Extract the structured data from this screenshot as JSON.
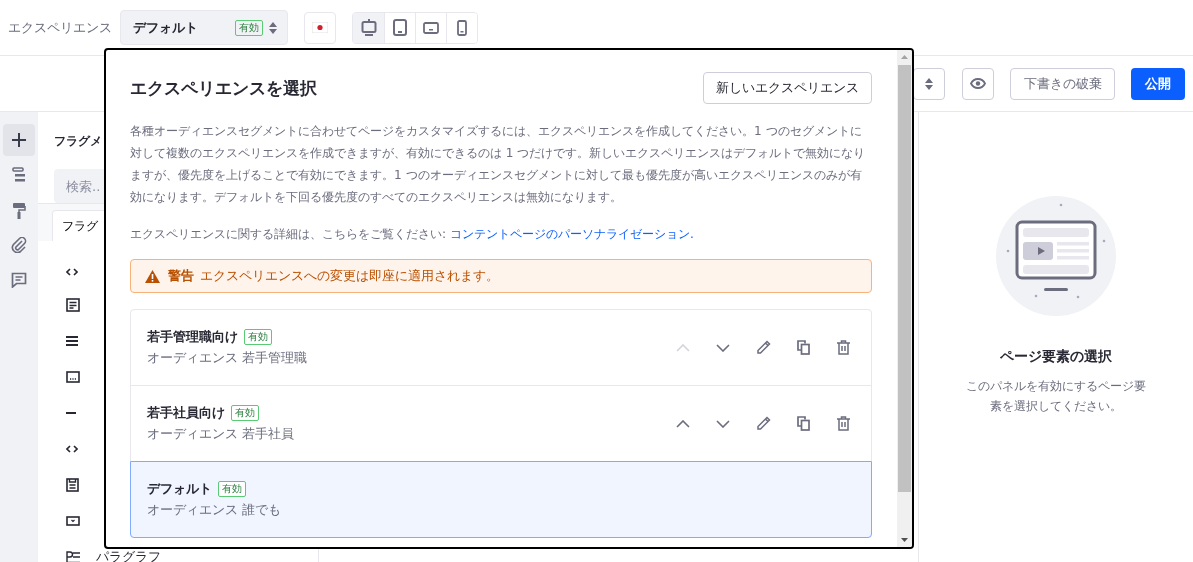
{
  "top_bar": {
    "label": "エクスペリエンス",
    "experience_select": {
      "value": "デフォルト",
      "badge": "有効"
    },
    "devices": [
      {
        "kind": "desktop",
        "selected": true
      },
      {
        "kind": "tablet",
        "selected": false
      },
      {
        "kind": "landscape",
        "selected": false
      },
      {
        "kind": "phone",
        "selected": false
      }
    ]
  },
  "toolbar": {
    "discard_button": "下書きの破棄",
    "publish_button": "公開"
  },
  "sidebar": {
    "tools": [
      {
        "kind": "add",
        "selected": true
      },
      {
        "kind": "structure",
        "selected": false
      },
      {
        "kind": "style",
        "selected": false
      },
      {
        "kind": "attachment",
        "selected": false
      },
      {
        "kind": "comment",
        "selected": false
      }
    ]
  },
  "fragments_panel": {
    "title": "フラグメ",
    "search_placeholder": "検索..",
    "tab": "フラグ",
    "items": [
      {
        "kind": "code"
      },
      {
        "kind": "card"
      },
      {
        "kind": "list"
      },
      {
        "kind": "dots"
      },
      {
        "kind": "separator"
      },
      {
        "kind": "code"
      },
      {
        "kind": "doc"
      },
      {
        "kind": "dropdown"
      },
      {
        "kind": "paragraph",
        "label": "パラグラフ"
      }
    ]
  },
  "modal": {
    "title": "エクスペリエンスを選択",
    "new_button": "新しいエクスペリエンス",
    "description": "各種オーディエンスセグメントに合わせてページをカスタマイズするには、エクスペリエンスを作成してください。1 つのセグメントに対して複数のエクスペリエンスを作成できますが、有効にできるのは 1 つだけです。新しいエクスペリエンスはデフォルトで無効になりますが、優先度を上げることで有効にできます。1 つのオーディエンスセグメントに対して最も優先度が高いエクスペリエンスのみが有効になります。デフォルトを下回る優先度のすべてのエクスペリエンスは無効になります。",
    "more_info": {
      "text": "エクスペリエンスに関する詳細は、こちらをご覧ください:",
      "link": "コンテントページのパーソナライゼーション."
    },
    "alert": {
      "label": "警告",
      "message": "エクスペリエンスへの変更は即座に適用されます。"
    },
    "experiences": [
      {
        "kind": "custom",
        "name": "若手管理職向け",
        "badge": "有効",
        "audience": "オーディエンス 若手管理職",
        "selected": false,
        "move_up_disabled": true
      },
      {
        "kind": "custom",
        "name": "若手社員向け",
        "badge": "有効",
        "audience": "オーディエンス 若手社員",
        "selected": false,
        "move_up_disabled": false
      },
      {
        "kind": "default",
        "name": "デフォルト",
        "badge": "有効",
        "audience": "オーディエンス 誰でも",
        "selected": true
      }
    ]
  },
  "side_panel": {
    "title": "ページ要素の選択",
    "description": "このパネルを有効にするページ要素を選択してください。"
  }
}
